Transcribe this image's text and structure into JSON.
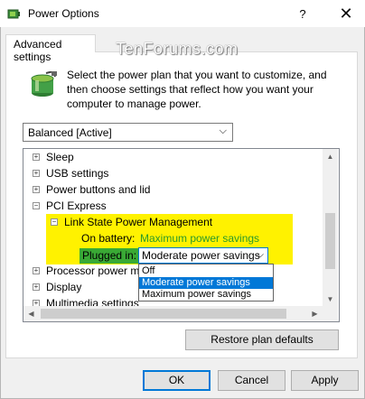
{
  "window": {
    "title": "Power Options",
    "help_glyph": "?",
    "close_glyph": "✕"
  },
  "tab": {
    "label": "Advanced settings"
  },
  "watermark": "TenForums.com",
  "description": "Select the power plan that you want to customize, and then choose settings that reflect how you want your computer to manage power.",
  "plan": {
    "selected": "Balanced [Active]"
  },
  "tree": {
    "items": [
      {
        "label": "Sleep",
        "expander": "+"
      },
      {
        "label": "USB settings",
        "expander": "+"
      },
      {
        "label": "Power buttons and lid",
        "expander": "+"
      },
      {
        "label": "PCI Express",
        "expander": "−"
      },
      {
        "label": "Link State Power Management",
        "expander": "−"
      }
    ],
    "on_battery": {
      "label": "On battery:",
      "value": "Maximum power savings"
    },
    "plugged_in": {
      "label": "Plugged in:",
      "value": "Moderate power savings"
    },
    "after_items": [
      {
        "label": "Processor power ma",
        "expander": "+"
      },
      {
        "label": "Display",
        "expander": "+"
      },
      {
        "label": "Multimedia settings",
        "expander": "+"
      }
    ]
  },
  "dropdown": {
    "options": [
      "Off",
      "Moderate power savings",
      "Maximum power savings"
    ],
    "selected_index": 1
  },
  "buttons": {
    "restore": "Restore plan defaults",
    "ok": "OK",
    "cancel": "Cancel",
    "apply": "Apply"
  },
  "colors": {
    "highlight": "#fff200",
    "plugged_label_bg": "#39a935",
    "on_battery_value": "#2a9a2a",
    "selection": "#0078d7"
  }
}
